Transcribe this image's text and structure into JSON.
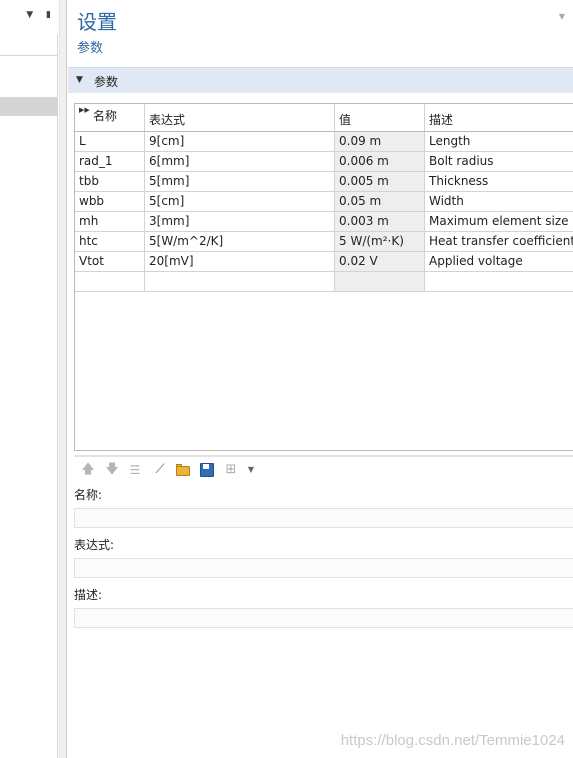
{
  "settings": {
    "title": "设置",
    "subtitle": "参数",
    "section_label": "参数"
  },
  "table": {
    "headers": [
      "名称",
      "表达式",
      "值",
      "描述"
    ],
    "rows": [
      [
        "L",
        "9[cm]",
        "0.09 m",
        "Length"
      ],
      [
        "rad_1",
        "6[mm]",
        "0.006 m",
        "Bolt radius"
      ],
      [
        "tbb",
        "5[mm]",
        "0.005 m",
        "Thickness"
      ],
      [
        "wbb",
        "5[cm]",
        "0.05 m",
        "Width"
      ],
      [
        "mh",
        "3[mm]",
        "0.003 m",
        "Maximum element size"
      ],
      [
        "htc",
        "5[W/m^2/K]",
        "5 W/(m²·K)",
        "Heat transfer coefficient"
      ],
      [
        "Vtot",
        "20[mV]",
        "0.02 V",
        "Applied voltage"
      ],
      [
        "",
        "",
        "",
        ""
      ]
    ]
  },
  "toolbar": {
    "icons": [
      "arrow-up-icon",
      "arrow-down-icon",
      "list-icon",
      "broom-icon",
      "folder-open-icon",
      "save-icon",
      "table-icon",
      "dropdown-arrow-icon"
    ]
  },
  "form": {
    "name_label": "名称:",
    "name_value": "",
    "expression_label": "表达式:",
    "expression_value": "",
    "description_label": "描述:",
    "description_value": ""
  },
  "watermark": "https://blog.csdn.net/Temmie1024"
}
